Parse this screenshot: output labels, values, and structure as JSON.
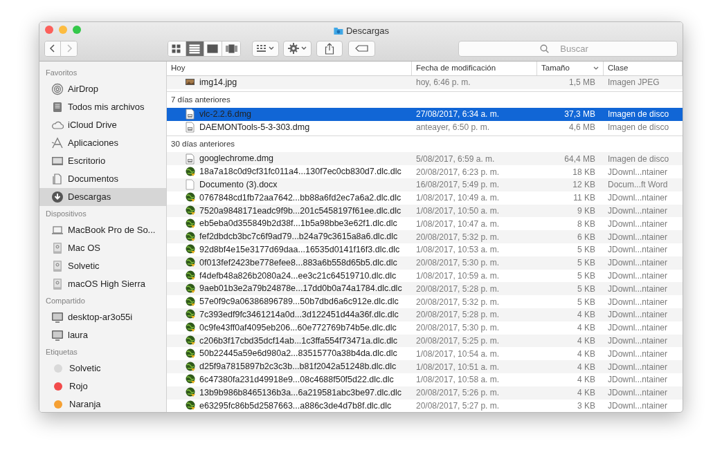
{
  "window": {
    "title": "Descargas"
  },
  "toolbar": {
    "views": [
      {
        "kind": "icons",
        "selected": false
      },
      {
        "kind": "list",
        "selected": true
      },
      {
        "kind": "columns",
        "selected": false
      },
      {
        "kind": "coverflow",
        "selected": false
      }
    ],
    "search": {
      "placeholder": "Buscar"
    }
  },
  "sidebar": {
    "sections": [
      {
        "title": "Favoritos",
        "items": [
          {
            "label": "AirDrop",
            "kind": "airdrop",
            "selected": false
          },
          {
            "label": "Todos mis archivos",
            "kind": "allfiles",
            "selected": false
          },
          {
            "label": "iCloud Drive",
            "kind": "cloud",
            "selected": false
          },
          {
            "label": "Aplicaciones",
            "kind": "apps",
            "selected": false
          },
          {
            "label": "Escritorio",
            "kind": "desktop",
            "selected": false
          },
          {
            "label": "Documentos",
            "kind": "documents",
            "selected": false
          },
          {
            "label": "Descargas",
            "kind": "downloads",
            "selected": true
          }
        ]
      },
      {
        "title": "Dispositivos",
        "items": [
          {
            "label": "MacBook Pro de So...",
            "kind": "laptop",
            "selected": false
          },
          {
            "label": "Mac OS",
            "kind": "disk",
            "selected": false
          },
          {
            "label": "Solvetic",
            "kind": "disk",
            "selected": false
          },
          {
            "label": "macOS High Sierra",
            "kind": "disk",
            "selected": false
          }
        ]
      },
      {
        "title": "Compartido",
        "items": [
          {
            "label": "desktop-ar3o55i",
            "kind": "monitor",
            "selected": false
          },
          {
            "label": "laura",
            "kind": "monitor",
            "selected": false
          }
        ]
      },
      {
        "title": "Etiquetas",
        "items": [
          {
            "label": "Solvetic",
            "kind": "tag",
            "color": "#d9d9d9",
            "selected": false
          },
          {
            "label": "Rojo",
            "kind": "tag",
            "color": "#f24b4b",
            "selected": false
          },
          {
            "label": "Naranja",
            "kind": "tag",
            "color": "#f5a033",
            "selected": false
          }
        ]
      }
    ]
  },
  "table": {
    "columns": [
      {
        "label": "Hoy",
        "sorted": false
      },
      {
        "label": "Fecha de modificación",
        "sorted": false
      },
      {
        "label": "Tamaño",
        "sorted": true
      },
      {
        "label": "Clase",
        "sorted": false
      }
    ],
    "groups": [
      {
        "rows": [
          {
            "name": "img14.jpg",
            "kind": "image",
            "date": "hoy, 6:46 p. m.",
            "size": "1,5 MB",
            "class": "Imagen JPEG",
            "selected": false
          }
        ]
      },
      {
        "title": "7 días anteriores",
        "rows": [
          {
            "name": "vlc-2.2.6.dmg",
            "kind": "disk",
            "date": "27/08/2017, 6:34 a. m.",
            "size": "37,3 MB",
            "class": "Imagen de disco",
            "selected": true
          },
          {
            "name": "DAEMONTools-5-3-303.dmg",
            "kind": "disk",
            "date": "anteayer, 6:50 p. m.",
            "size": "4,6 MB",
            "class": "Imagen de disco",
            "selected": false
          }
        ]
      },
      {
        "title": "30 días anteriores",
        "rows": [
          {
            "name": "googlechrome.dmg",
            "kind": "disk",
            "date": "5/08/2017, 6:59 a. m.",
            "size": "64,4 MB",
            "class": "Imagen de disco",
            "selected": false
          },
          {
            "name": "18a7a18c0d9cf31fc011a4...130f7ec0cb830d7.dlc.dlc",
            "kind": "globe",
            "date": "20/08/2017, 6:23 p. m.",
            "size": "18 KB",
            "class": "JDownl...ntainer",
            "selected": false
          },
          {
            "name": "Documento (3).docx",
            "kind": "doc",
            "date": "16/08/2017, 5:49 p. m.",
            "size": "12 KB",
            "class": "Docum...ft Word",
            "selected": false
          },
          {
            "name": "0767848cd1fb72aa7642...bb88a6fd2ec7a6a2.dlc.dlc",
            "kind": "globe",
            "date": "1/08/2017, 10:49 a. m.",
            "size": "11 KB",
            "class": "JDownl...ntainer",
            "selected": false
          },
          {
            "name": "7520a9848171eadc9f9b...201c5458197f61ee.dlc.dlc",
            "kind": "globe",
            "date": "1/08/2017, 10:50 a. m.",
            "size": "9 KB",
            "class": "JDownl...ntainer",
            "selected": false
          },
          {
            "name": "eb5eba0d355849b2d38f...1b5a98bbe3e62f1.dlc.dlc",
            "kind": "globe",
            "date": "1/08/2017, 10:47 a. m.",
            "size": "8 KB",
            "class": "JDownl...ntainer",
            "selected": false
          },
          {
            "name": "fef2dbdcb3bc7c6f9ad79...b24a79c3615a8a6.dlc.dlc",
            "kind": "globe",
            "date": "20/08/2017, 5:32 p. m.",
            "size": "6 KB",
            "class": "JDownl...ntainer",
            "selected": false
          },
          {
            "name": "92d8bf4e15e3177d69daa...16535d0141f16f3.dlc.dlc",
            "kind": "globe",
            "date": "1/08/2017, 10:53 a. m.",
            "size": "5 KB",
            "class": "JDownl...ntainer",
            "selected": false
          },
          {
            "name": "0f013fef2423be778efee8...883a6b558d65b5.dlc.dlc",
            "kind": "globe",
            "date": "20/08/2017, 5:30 p. m.",
            "size": "5 KB",
            "class": "JDownl...ntainer",
            "selected": false
          },
          {
            "name": "f4defb48a826b2080a24...ee3c21c64519710.dlc.dlc",
            "kind": "globe",
            "date": "1/08/2017, 10:59 a. m.",
            "size": "5 KB",
            "class": "JDownl...ntainer",
            "selected": false
          },
          {
            "name": "9aeb01b3e2a79b24878e...17dd0b0a74a1784.dlc.dlc",
            "kind": "globe",
            "date": "20/08/2017, 5:28 p. m.",
            "size": "5 KB",
            "class": "JDownl...ntainer",
            "selected": false
          },
          {
            "name": "57e0f9c9a06386896789...50b7dbd6a6c912e.dlc.dlc",
            "kind": "globe",
            "date": "20/08/2017, 5:32 p. m.",
            "size": "5 KB",
            "class": "JDownl...ntainer",
            "selected": false
          },
          {
            "name": "7c393edf9fc3461214a0d...3d122451d44a36f.dlc.dlc",
            "kind": "globe",
            "date": "20/08/2017, 5:28 p. m.",
            "size": "4 KB",
            "class": "JDownl...ntainer",
            "selected": false
          },
          {
            "name": "0c9fe43ff0af4095eb206...60e772769b74b5e.dlc.dlc",
            "kind": "globe",
            "date": "20/08/2017, 5:30 p. m.",
            "size": "4 KB",
            "class": "JDownl...ntainer",
            "selected": false
          },
          {
            "name": "c206b3f17cbd35dcf14ab...1c3ffa554f73471a.dlc.dlc",
            "kind": "globe",
            "date": "20/08/2017, 5:25 p. m.",
            "size": "4 KB",
            "class": "JDownl...ntainer",
            "selected": false
          },
          {
            "name": "50b22445a59e6d980a2...83515770a38b4da.dlc.dlc",
            "kind": "globe",
            "date": "1/08/2017, 10:54 a. m.",
            "size": "4 KB",
            "class": "JDownl...ntainer",
            "selected": false
          },
          {
            "name": "d25f9a7815897b2c3c3b...b81f2042a51248b.dlc.dlc",
            "kind": "globe",
            "date": "1/08/2017, 10:51 a. m.",
            "size": "4 KB",
            "class": "JDownl...ntainer",
            "selected": false
          },
          {
            "name": "6c47380fa231d49918e9...08c4688f50f5d22.dlc.dlc",
            "kind": "globe",
            "date": "1/08/2017, 10:58 a. m.",
            "size": "4 KB",
            "class": "JDownl...ntainer",
            "selected": false
          },
          {
            "name": "13b9b986b8465136b3a...6a219581abc3be97.dlc.dlc",
            "kind": "globe",
            "date": "20/08/2017, 5:26 p. m.",
            "size": "4 KB",
            "class": "JDownl...ntainer",
            "selected": false
          },
          {
            "name": "e63295fc86b5d2587663...a886c3de4d7b8f.dlc.dlc",
            "kind": "globe",
            "date": "20/08/2017, 5:27 p. m.",
            "size": "3 KB",
            "class": "JDownl...ntainer",
            "selected": false
          }
        ]
      }
    ]
  }
}
